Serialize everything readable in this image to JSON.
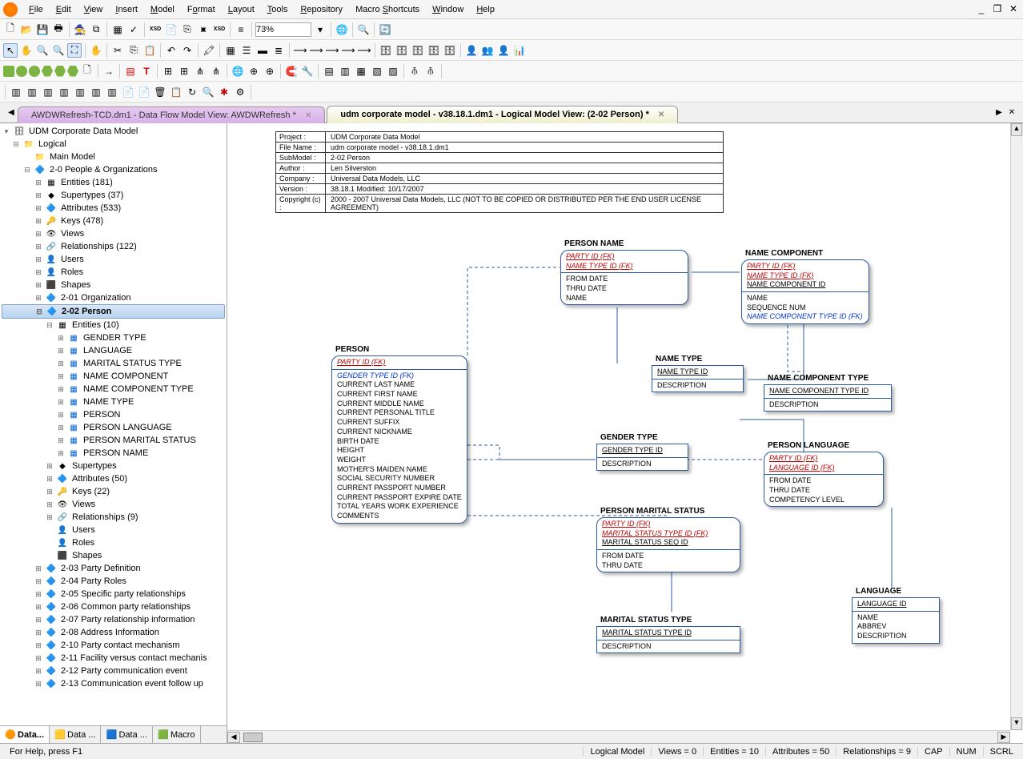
{
  "menu": {
    "items": [
      "File",
      "Edit",
      "View",
      "Insert",
      "Model",
      "Format",
      "Layout",
      "Tools",
      "Repository",
      "Macro Shortcuts",
      "Window",
      "Help"
    ],
    "accelerators": [
      "F",
      "E",
      "V",
      "I",
      "M",
      "o",
      "L",
      "T",
      "R",
      "S",
      "W",
      "H"
    ]
  },
  "zoom": "73%",
  "tabs": [
    {
      "label": "AWDWRefresh-TCD.dm1 - Data Flow Model View: AWDWRefresh *",
      "active": false
    },
    {
      "label": "udm corporate model - v38.18.1.dm1 - Logical Model View: (2-02 Person) *",
      "active": true
    }
  ],
  "tree": {
    "root": "UDM Corporate Data Model",
    "logical": "Logical",
    "main_model": "Main Model",
    "people_org": "2-0 People & Organizations",
    "items_po": [
      "Entities (181)",
      "Supertypes (37)",
      "Attributes (533)",
      "Keys (478)",
      "Views",
      "Relationships (122)",
      "Users",
      "Roles",
      "Shapes"
    ],
    "org": "2-01 Organization",
    "person": "2-02 Person",
    "entities_label": "Entities (10)",
    "entities": [
      "GENDER TYPE",
      "LANGUAGE",
      "MARITAL STATUS TYPE",
      "NAME COMPONENT",
      "NAME COMPONENT TYPE",
      "NAME TYPE",
      "PERSON",
      "PERSON LANGUAGE",
      "PERSON MARITAL STATUS",
      "PERSON NAME"
    ],
    "sub_person": [
      "Supertypes",
      "Attributes (50)",
      "Keys (22)",
      "Views",
      "Relationships (9)",
      "Users",
      "Roles",
      "Shapes"
    ],
    "more": [
      "2-03 Party Definition",
      "2-04 Party Roles",
      "2-05 Specific party relationships",
      "2-06 Common party relationships",
      "2-07 Party relationship information",
      "2-08 Address Information",
      "2-10 Party contact mechanism",
      "2-11 Facility versus contact mechanis",
      "2-12 Party communication event",
      "2-13 Communication event follow up"
    ]
  },
  "bottom_tabs": [
    "Data...",
    "Data ...",
    "Data ...",
    "Macro"
  ],
  "info": {
    "project_l": "Project :",
    "project": "UDM Corporate Data Model",
    "filename_l": "File Name :",
    "filename": "udm corporate model - v38.18.1.dm1",
    "submodel_l": "SubModel :",
    "submodel": "2-02 Person",
    "author_l": "Author :",
    "author": "Len Silverston",
    "company_l": "Company :",
    "company": "Universal Data Models, LLC",
    "version_l": "Version :",
    "version": "38.18.1        Modified:       10/17/2007",
    "copyright_l": "Copyright (c) :",
    "copyright": "2000 - 2007 Universal Data Models, LLC (NOT TO BE COPIED OR DISTRIBUTED PER THE END USER LICENSE AGREEMENT)"
  },
  "entities": {
    "person": {
      "title": "PERSON",
      "keys": [
        "PARTY ID (FK)"
      ],
      "fk_attrs": [
        "GENDER TYPE ID (FK)"
      ],
      "attrs": [
        "CURRENT LAST NAME",
        "CURRENT FIRST NAME",
        "CURRENT MIDDLE NAME",
        "CURRENT PERSONAL TITLE",
        "CURRENT SUFFIX",
        "CURRENT NICKNAME",
        "BIRTH DATE",
        "HEIGHT",
        "WEIGHT",
        "MOTHER'S MAIDEN NAME",
        "SOCIAL SECURITY NUMBER",
        "CURRENT PASSPORT NUMBER",
        "CURRENT PASSPORT EXPIRE DATE",
        "TOTAL YEARS WORK EXPERIENCE",
        "COMMENTS"
      ]
    },
    "person_name": {
      "title": "PERSON NAME",
      "keys": [
        "PARTY ID (FK)",
        "NAME TYPE ID (FK)"
      ],
      "attrs": [
        "FROM DATE",
        "THRU DATE",
        "NAME"
      ]
    },
    "name_type": {
      "title": "NAME TYPE",
      "keys": [
        "NAME TYPE ID"
      ],
      "attrs": [
        "DESCRIPTION"
      ]
    },
    "gender_type": {
      "title": "GENDER TYPE",
      "keys": [
        "GENDER TYPE ID"
      ],
      "attrs": [
        "DESCRIPTION"
      ]
    },
    "person_marital": {
      "title": "PERSON MARITAL STATUS",
      "keys": [
        "PARTY ID (FK)",
        "MARITAL STATUS TYPE ID (FK)",
        "MARITAL STATUS SEQ ID"
      ],
      "attrs": [
        "FROM DATE",
        "THRU DATE"
      ]
    },
    "marital_type": {
      "title": "MARITAL STATUS TYPE",
      "keys": [
        "MARITAL STATUS TYPE ID"
      ],
      "attrs": [
        "DESCRIPTION"
      ]
    },
    "name_component": {
      "title": "NAME COMPONENT",
      "keys": [
        "PARTY ID (FK)",
        "NAME TYPE ID (FK)",
        "NAME COMPONENT ID"
      ],
      "attrs": [
        "NAME",
        "SEQUENCE NUM"
      ],
      "fk_after": [
        "NAME COMPONENT TYPE ID (FK)"
      ]
    },
    "name_comp_type": {
      "title": "NAME COMPONENT TYPE",
      "keys": [
        "NAME COMPONENT TYPE ID"
      ],
      "attrs": [
        "DESCRIPTION"
      ]
    },
    "person_lang": {
      "title": "PERSON LANGUAGE",
      "keys": [
        "PARTY ID (FK)",
        "LANGUAGE ID (FK)"
      ],
      "attrs": [
        "FROM DATE",
        "THRU DATE",
        "COMPETENCY LEVEL"
      ]
    },
    "language": {
      "title": "LANGUAGE",
      "keys": [
        "LANGUAGE ID"
      ],
      "attrs": [
        "NAME",
        "ABBREV",
        "DESCRIPTION"
      ]
    }
  },
  "status": {
    "help": "For Help, press F1",
    "model": "Logical Model",
    "views": "Views = 0",
    "entities": "Entities = 10",
    "attributes": "Attributes = 50",
    "relationships": "Relationships = 9",
    "cap": "CAP",
    "num": "NUM",
    "scrl": "SCRL"
  }
}
